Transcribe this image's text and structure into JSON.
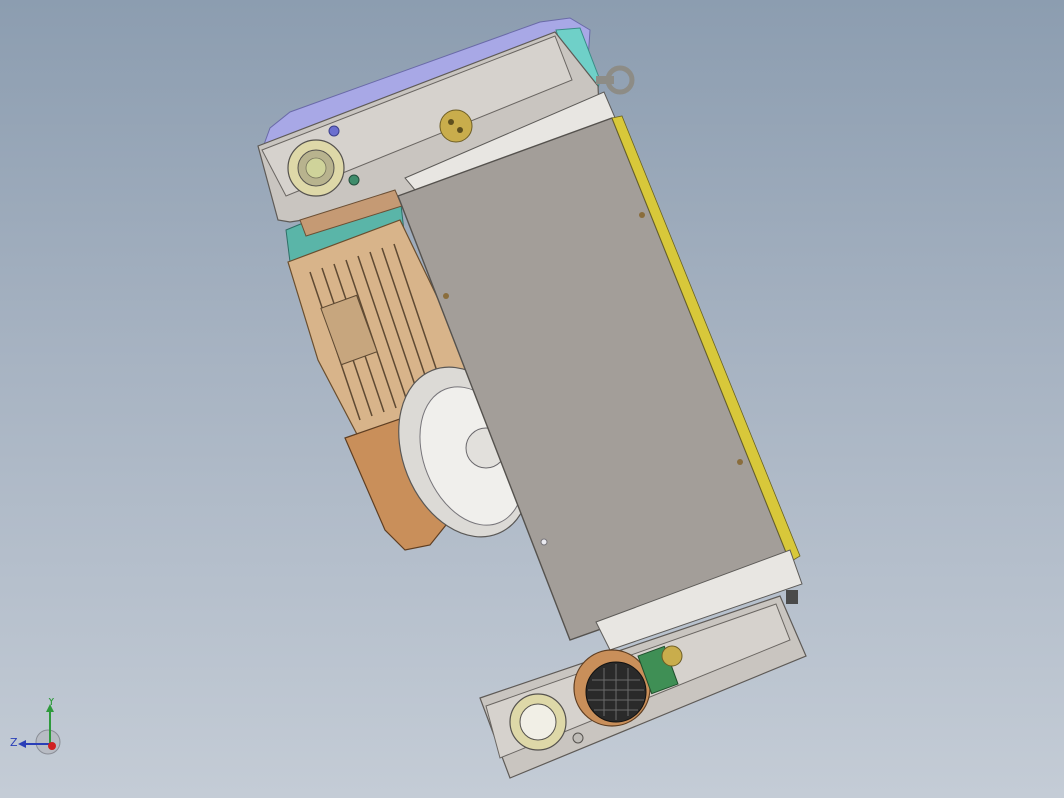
{
  "viewport": {
    "background_top": "#8c9db0",
    "background_bottom": "#c4ccd6"
  },
  "triad": {
    "y_label": "Y",
    "z_label": "Z",
    "y_color": "#2e9a3c",
    "z_color": "#2a3fb8",
    "x_color": "#d02020"
  },
  "model": {
    "housing_color": "#c9c5c0",
    "plate_color": "#a39e99",
    "motor_color": "#d8b48a",
    "fan_color": "#5ab5a8",
    "top_cover_color": "#a8a8e6",
    "accent_yellow": "#d8c83a",
    "gear_icon": "gear-icon"
  }
}
